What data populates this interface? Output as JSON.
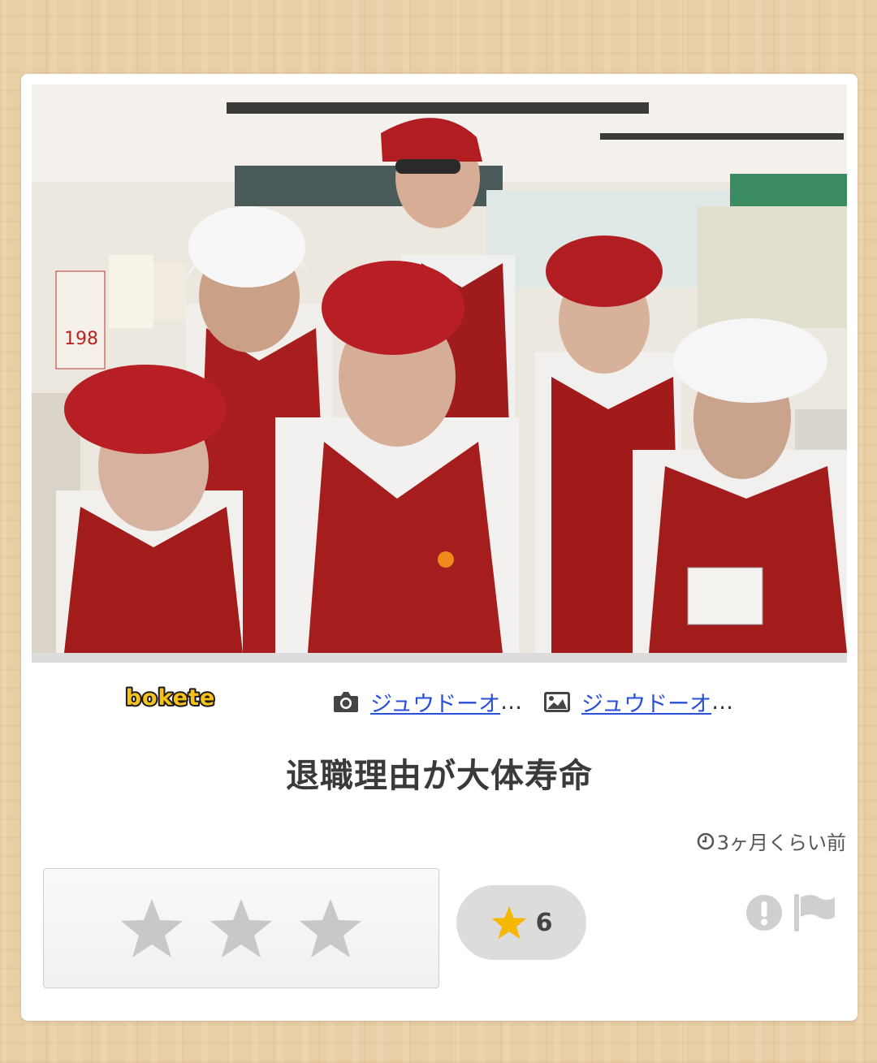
{
  "post": {
    "title": "退職理由が大体寿命",
    "time_ago": "3ヶ月くらい前",
    "photo_credit": "ジュウドーオ",
    "image_credit": "ジュウドーオ",
    "ellipsis": "…",
    "star_count": "6"
  },
  "brand": {
    "logo_text": "bokete"
  },
  "rating": {
    "stars_total": 3,
    "stars_selected": 0
  },
  "icons": {
    "photo_credit": "camera-icon",
    "image_credit": "image-icon",
    "time": "clock-icon",
    "count": "star-icon",
    "report": "exclamation-circle-icon",
    "flag": "flag-icon"
  },
  "colors": {
    "link": "#2a4fd8",
    "star_gold": "#f5b800",
    "star_empty": "#c8c8c8",
    "logo_yellow": "#f6c21a"
  }
}
